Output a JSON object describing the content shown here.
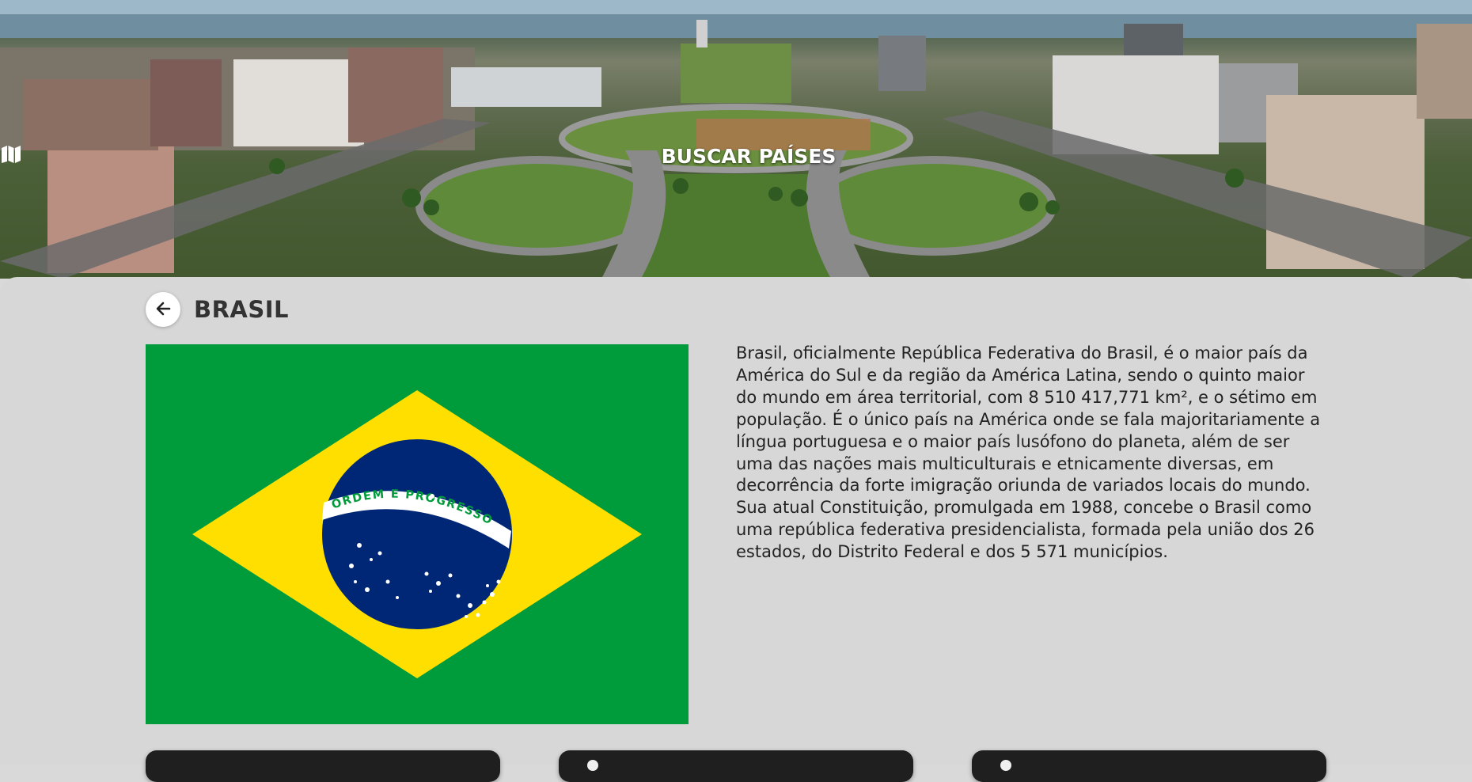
{
  "header": {
    "title": "BUSCAR PAÍSES",
    "icon": "map-icon"
  },
  "country": {
    "name": "BRASIL",
    "back_icon": "arrow-left-icon",
    "flag": {
      "motto": "ORDEM E PROGRESSO",
      "colors": {
        "green": "#009c3b",
        "yellow": "#ffdf00",
        "blue": "#002776",
        "white": "#ffffff"
      }
    },
    "description": "Brasil, oficialmente República Federativa do Brasil, é o maior país da América do Sul e da região da América Latina, sendo o quinto maior do mundo em área territorial, com 8 510 417,771 km², e o sétimo em população. É o único país na América onde se fala majoritariamente a língua portuguesa e o maior país lusófono do planeta, além de ser uma das nações mais multiculturais e etnicamente diversas, em decorrência da forte imigração oriunda de variados locais do mundo. Sua atual Constituição, promulgada em 1988, concebe o Brasil como uma república federativa presidencialista, formada pela união dos 26 estados, do Distrito Federal e dos 5 571 municípios."
  },
  "cards": [
    {
      "icon": "info-card-icon"
    },
    {
      "icon": "info-card-icon"
    },
    {
      "icon": "info-card-icon"
    }
  ]
}
